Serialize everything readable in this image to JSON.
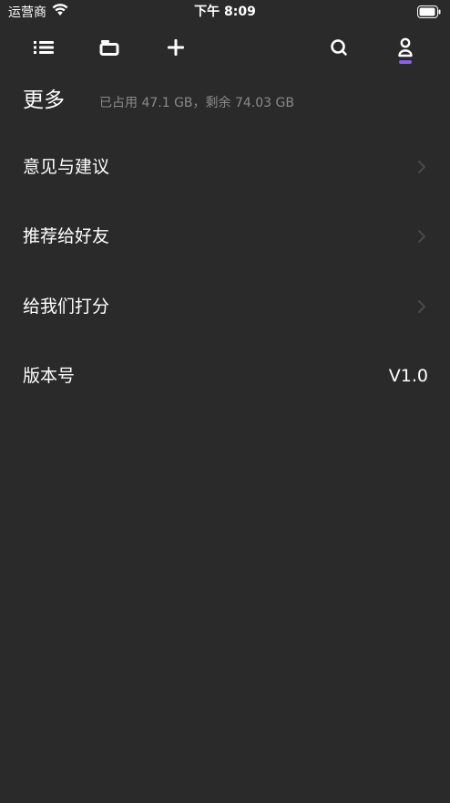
{
  "status_bar": {
    "carrier": "运营商",
    "time": "下午 8:09",
    "icons": [
      "wifi-icon",
      "battery-icon"
    ]
  },
  "toolbar": {
    "icons": [
      "list-icon",
      "folder-icon",
      "plus-icon",
      "search-icon",
      "user-icon"
    ],
    "active": "user-icon",
    "accent_color": "#8b5cf6"
  },
  "header": {
    "title": "更多",
    "storage": "已占用 47.1 GB，剩余 74.03 GB"
  },
  "menu": {
    "items": [
      {
        "label": "意见与建议",
        "icon": "chevron-right-icon"
      },
      {
        "label": "推荐给好友",
        "icon": "chevron-right-icon"
      },
      {
        "label": "给我们打分",
        "icon": "chevron-right-icon"
      },
      {
        "label": "版本号",
        "value": "V1.0"
      }
    ]
  },
  "colors": {
    "background": "#2a2a2a",
    "text": "#ffffff",
    "secondary_text": "#8a8a8a",
    "chevron": "#4a4a4a"
  }
}
